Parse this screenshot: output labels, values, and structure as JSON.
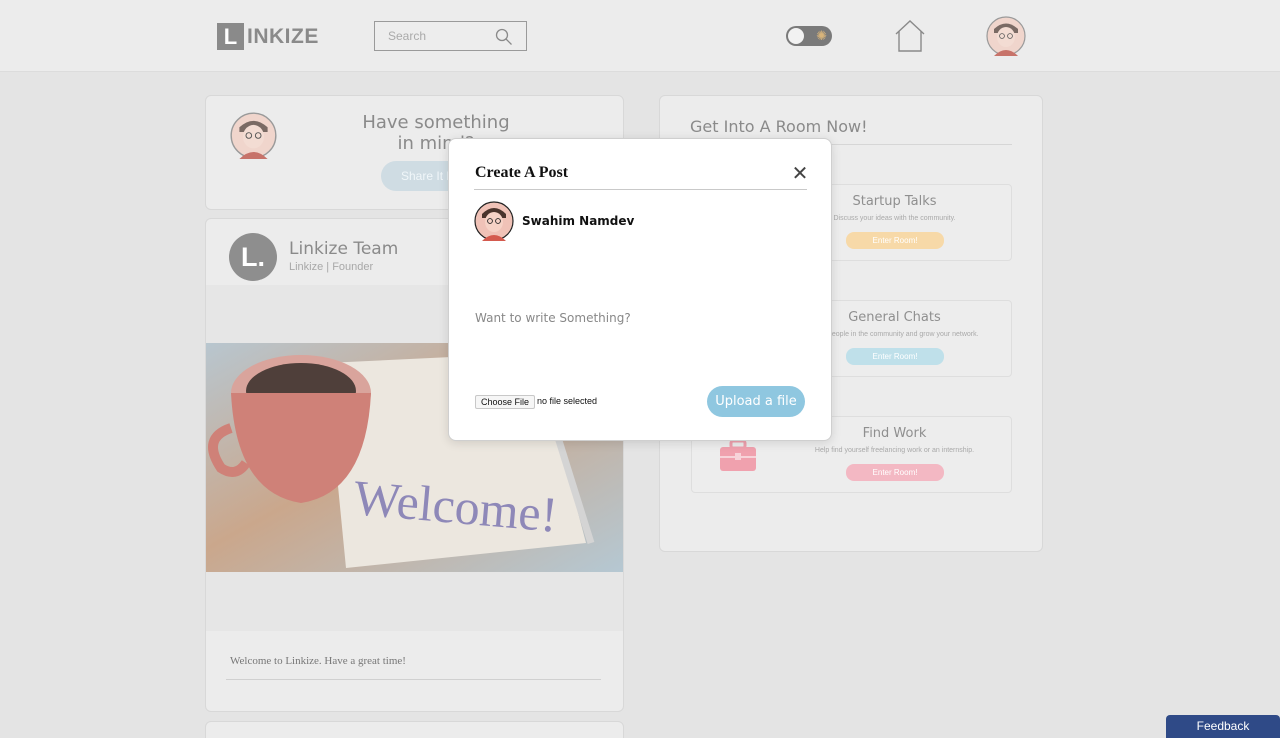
{
  "header": {
    "logo_letter": "L",
    "logo_text": "INKIZE",
    "search_placeholder": "Search",
    "toggle_icon": "sun-icon",
    "home_icon": "home-icon",
    "profile_icon": "avatar"
  },
  "compose": {
    "headline_line1": "Have something",
    "headline_line2": "in mind?",
    "share_label": "Share It Now"
  },
  "post": {
    "author_initial": "L.",
    "author_name": "Linkize Team",
    "author_meta": "Linkize | Founder",
    "image_text": "Welcome!",
    "caption": "Welcome to Linkize. Have a great time!"
  },
  "rooms": {
    "title": "Get Into A Room Now!",
    "items": [
      {
        "title": "Startup Talks",
        "description": "Discuss your ideas with the community.",
        "button": "Enter Room!",
        "color": "#f7d9a8"
      },
      {
        "title": "General Chats",
        "description": "Meet people in the community and grow your network.",
        "button": "Enter Room!",
        "color": "#bfe0ea"
      },
      {
        "title": "Find Work",
        "description": "Help find yourself freelancing work or an internship.",
        "button": "Enter Room!",
        "color": "#f3b8c3"
      }
    ]
  },
  "modal": {
    "title": "Create A Post",
    "close_label": "✕",
    "user_name": "Swahim Namdev",
    "textarea_placeholder": "Want to write Something?",
    "choose_file_label": "Choose File",
    "file_status": "no file selected",
    "upload_label": "Upload a file",
    "accent": "#8fc7e0"
  },
  "feedback_label": "Feedback"
}
